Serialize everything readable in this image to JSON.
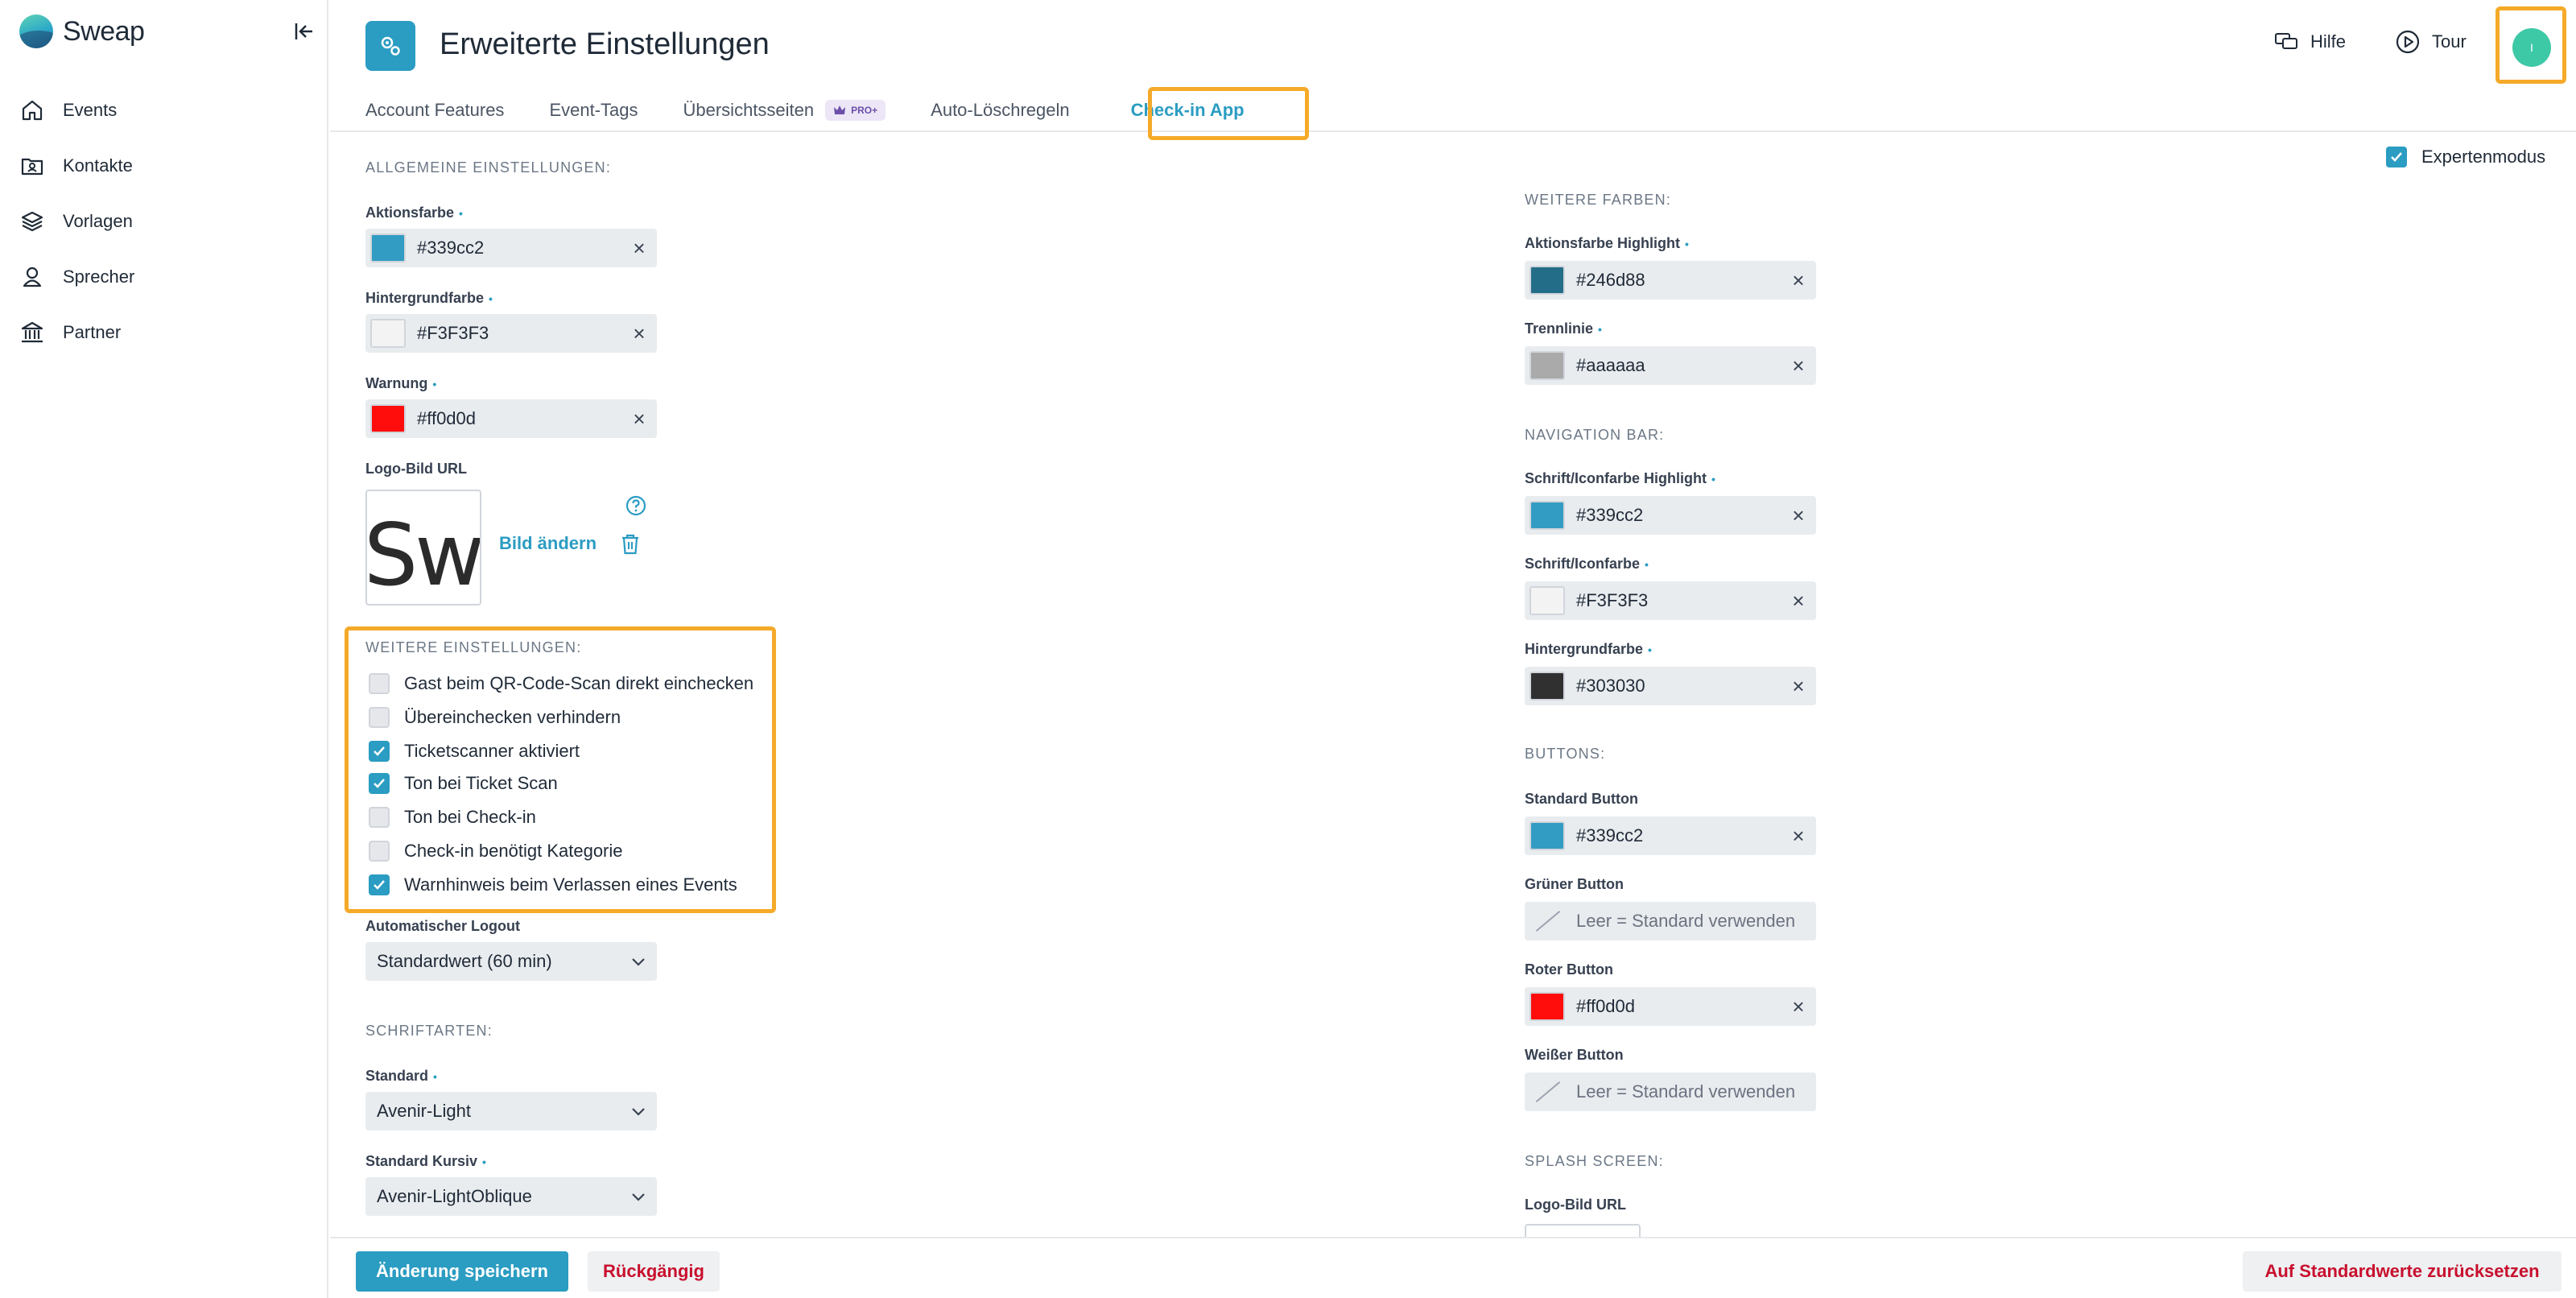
{
  "app": {
    "name": "Sweap"
  },
  "sidebar": {
    "items": [
      {
        "label": "Events",
        "icon": "home-icon"
      },
      {
        "label": "Kontakte",
        "icon": "contacts-icon"
      },
      {
        "label": "Vorlagen",
        "icon": "layers-icon"
      },
      {
        "label": "Sprecher",
        "icon": "speaker-icon"
      },
      {
        "label": "Partner",
        "icon": "bank-icon"
      }
    ]
  },
  "header": {
    "title": "Erweiterte Einstellungen",
    "help_label": "Hilfe",
    "tour_label": "Tour",
    "avatar_initial": "I",
    "tabs": [
      {
        "label": "Account Features"
      },
      {
        "label": "Event-Tags"
      },
      {
        "label": "Übersichtsseiten",
        "badge": "PRO+"
      },
      {
        "label": "Auto-Löschregeln"
      },
      {
        "label": "Check-in App",
        "active": true
      }
    ]
  },
  "expert_mode": {
    "label": "Expertenmodus",
    "checked": true
  },
  "left": {
    "general_title": "ALLGEMEINE EINSTELLUNGEN:",
    "aktionsfarbe": {
      "label": "Aktionsfarbe",
      "value": "#339cc2",
      "color": "#339cc2"
    },
    "hintergrundfarbe": {
      "label": "Hintergrundfarbe",
      "value": "#F3F3F3",
      "color": "#F3F3F3"
    },
    "warnung": {
      "label": "Warnung",
      "value": "#ff0d0d",
      "color": "#ff0d0d"
    },
    "logo": {
      "label": "Logo-Bild URL",
      "change_label": "Bild ändern",
      "preview_text": "Swe"
    },
    "weitere_title": "WEITERE EINSTELLUNGEN:",
    "checkboxes": [
      {
        "label": "Gast beim QR-Code-Scan direkt einchecken",
        "checked": false
      },
      {
        "label": "Übereinchecken verhindern",
        "checked": false
      },
      {
        "label": "Ticketscanner aktiviert",
        "checked": true
      },
      {
        "label": "Ton bei Ticket Scan",
        "checked": true
      },
      {
        "label": "Ton bei Check-in",
        "checked": false
      },
      {
        "label": "Check-in benötigt Kategorie",
        "checked": false
      },
      {
        "label": "Warnhinweis beim Verlassen eines Events",
        "checked": true
      }
    ],
    "logout": {
      "label": "Automatischer Logout",
      "value": "Standardwert (60 min)"
    },
    "fonts_title": "SCHRIFTARTEN:",
    "font_standard": {
      "label": "Standard",
      "value": "Avenir-Light"
    },
    "font_italic": {
      "label": "Standard Kursiv",
      "value": "Avenir-LightOblique"
    }
  },
  "right": {
    "more_colors_title": "WEITERE FARBEN:",
    "action_highlight": {
      "label": "Aktionsfarbe Highlight",
      "value": "#246d88",
      "color": "#246d88"
    },
    "trennlinie": {
      "label": "Trennlinie",
      "value": "#aaaaaa",
      "color": "#aaaaaa"
    },
    "navbar_title": "NAVIGATION BAR:",
    "nav_highlight": {
      "label": "Schrift/Iconfarbe Highlight",
      "value": "#339cc2",
      "color": "#339cc2"
    },
    "nav_font": {
      "label": "Schrift/Iconfarbe",
      "value": "#F3F3F3",
      "color": "#F3F3F3"
    },
    "nav_bg": {
      "label": "Hintergrundfarbe",
      "value": "#303030",
      "color": "#303030"
    },
    "buttons_title": "BUTTONS:",
    "btn_standard": {
      "label": "Standard Button",
      "value": "#339cc2",
      "color": "#339cc2"
    },
    "btn_green": {
      "label": "Grüner Button",
      "placeholder": "Leer = Standard verwenden"
    },
    "btn_red": {
      "label": "Roter Button",
      "value": "#ff0d0d",
      "color": "#ff0d0d"
    },
    "btn_white": {
      "label": "Weißer Button",
      "placeholder": "Leer = Standard verwenden"
    },
    "splash_title": "SPLASH SCREEN:",
    "splash_logo_label": "Logo-Bild URL"
  },
  "footer": {
    "save_label": "Änderung speichern",
    "undo_label": "Rückgängig",
    "reset_label": "Auf Standardwerte zurücksetzen"
  },
  "colors": {
    "accent": "#2b9cc2",
    "highlight_border": "#f5aa2a",
    "danger": "#c8102e"
  }
}
